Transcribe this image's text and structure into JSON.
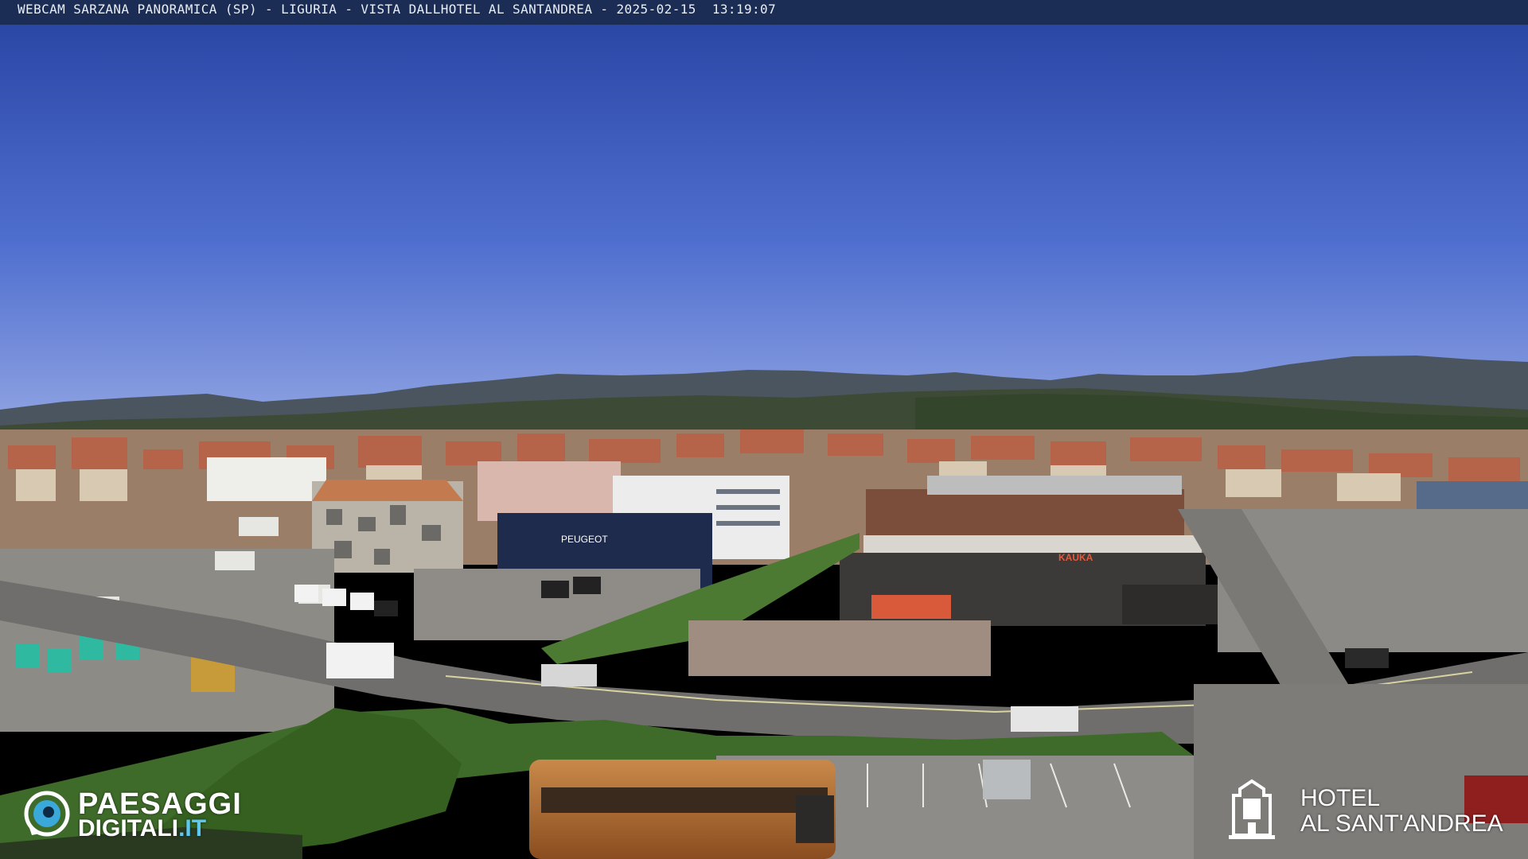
{
  "overlay": {
    "caption": "WEBCAM SARZANA PANORAMICA (SP) - LIGURIA - VISTA DALLHOTEL AL SANTANDREA - 2025-02-15  13:19:07"
  },
  "logo_left": {
    "line1": "PAESAGGI",
    "line2_main": "DIGITALI",
    "line2_suffix": ".IT",
    "icon": "eye-icon",
    "accent_color": "#5fc8ef"
  },
  "logo_right": {
    "line1": "HOTEL",
    "line2": "AL SANT'ANDREA",
    "icon": "hotel-emblem-icon"
  },
  "scene_signs": {
    "peugeot": "PEUGEOT",
    "kauka": "KAUKA"
  },
  "colors": {
    "sky_top": "#2a4aa8",
    "sky_bottom": "#7d93dd",
    "bar": "#1b2d55"
  }
}
